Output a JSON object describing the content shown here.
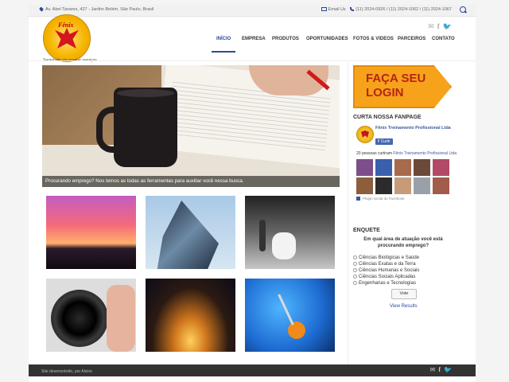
{
  "topbar": {
    "address": "Av. Abel Tavares, 427 - Jardim Belém, São Paulo, Brasil",
    "email_label": "Email Us",
    "phones": "(11) 2024-0926 / (11) 2024-1062 / (11) 2024-1067"
  },
  "brand": {
    "logo_text": "Fênix",
    "tagline": "Seriedade em prestar serviços"
  },
  "nav": {
    "items": [
      "INÍCIO",
      "EMPRESA",
      "PRODUTOS",
      "OPORTUNIDADES",
      "FOTOS & VIDEOS",
      "PARCEIROS",
      "CONTATO"
    ],
    "active_index": 0
  },
  "slider": {
    "caption": "Procurando emprego? Nos temos as todas as ferramentas para auxiliar você nessa busca.",
    "slides": 2,
    "active_slide": 0
  },
  "sidebar": {
    "login_button": "FAÇA SEU LOGIN",
    "fanpage_title": "CURTA NOSSA FANPAGE",
    "fb_page_name": "Fênix Treinamento Profissional Ltda",
    "fb_like": "Curtir",
    "fb_count_prefix": "20 pessoas curtiram",
    "fb_count_page": "Fênix Treinamento Profissional Ltda",
    "fb_plugin": "Plugin social do Facebook",
    "poll_title": "ENQUETE",
    "poll_question": "Em qual área de atuação você está procurando emprego?",
    "poll_options": [
      "Ciências Biológicas e Saúde",
      "Ciências Exatas e da Terra",
      "Ciências Humanas e Sociais",
      "Ciências Sociais Aplicadas",
      "Engenharias e Tecnologias"
    ],
    "vote_button": "Vote",
    "view_results": "View Results"
  },
  "footer": {
    "credit": "Site desenvolvido, por Alvine"
  },
  "colors": {
    "accent": "#2a4a9b",
    "login_bg": "#f7a21b",
    "login_text": "#b52515"
  }
}
